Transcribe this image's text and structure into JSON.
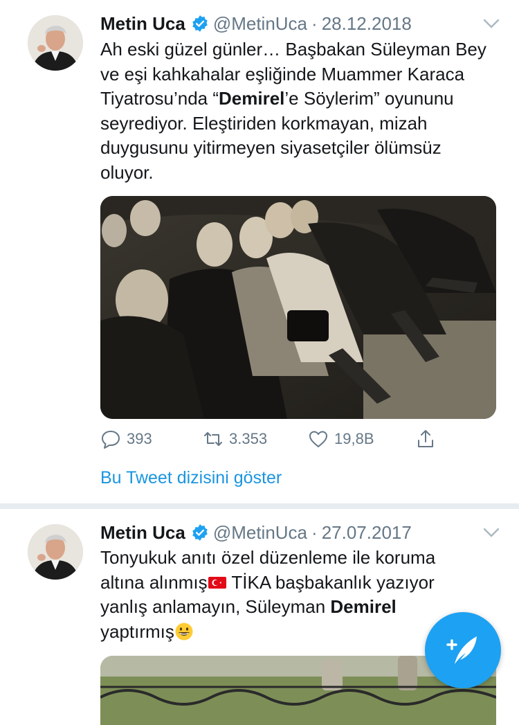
{
  "colors": {
    "accent": "#1da1f2",
    "link": "#1b95e0",
    "muted": "#657786",
    "text": "#14171a",
    "separator": "#e6ecf0"
  },
  "tweets": [
    {
      "author_name": "Metin Uca",
      "handle": "@MetinUca",
      "separator": "·",
      "date": "28.12.2018",
      "text_before": "Ah eski güzel günler… Başbakan Süleyman Bey ve eşi kahkahalar eşliğinde Muammer Karaca Tiyatrosu’nda “",
      "text_bold": "Demirel",
      "text_after": "’e Söylerim” oyununu seyrediyor. Eleştiriden korkmayan, mizah duygusunu yitirmeyen siyasetçiler ölümsüz oluyor.",
      "replies": "393",
      "retweets": "3.353",
      "likes": "19,8B",
      "thread_link": "Bu Tweet dizisini göster",
      "icons": [
        "verified-badge-icon",
        "chevron-down-icon",
        "reply-icon",
        "retweet-icon",
        "like-icon",
        "share-icon"
      ]
    },
    {
      "author_name": "Metin Uca",
      "handle": "@MetinUca",
      "separator": "·",
      "date": "27.07.2017",
      "text_line1": "Tonyukuk anıtı özel düzenleme ile koruma",
      "text_line2a": "altına alınmış",
      "text_line2b": " TİKA başbakanlık yazıyor",
      "text_line3a": "yanlış anlamayın, Süleyman ",
      "text_bold": "Demirel",
      "text_line4": "yaptırmış",
      "icons": [
        "turkey-flag-emoji",
        "grinning-emoji"
      ]
    }
  ],
  "compose_button": {
    "icon": "compose-feather-icon"
  }
}
